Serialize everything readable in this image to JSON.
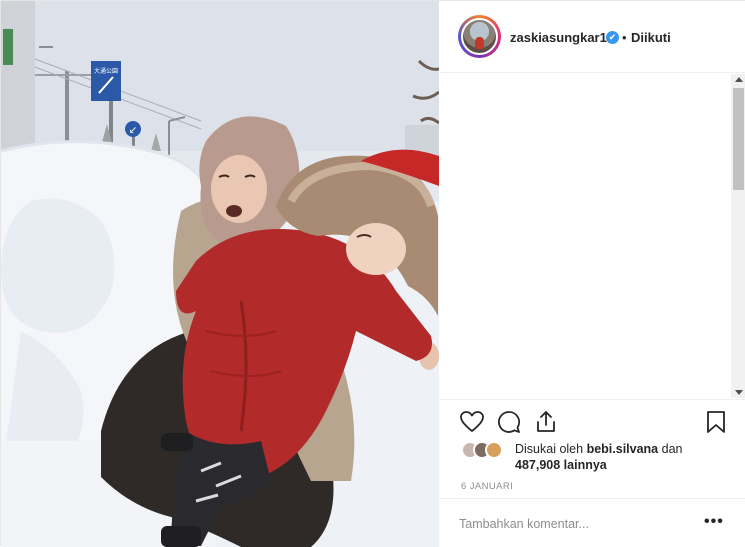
{
  "header": {
    "username": "zaskiasungkar15",
    "verified_mark": "✔",
    "separator": "•",
    "follow_status": "Diikuti"
  },
  "photo": {
    "street_sign_text": "大通公園",
    "road_sign": "↙"
  },
  "actions": {
    "like_icon": "heart-icon",
    "comment_icon": "comment-icon",
    "share_icon": "share-icon",
    "save_icon": "bookmark-icon"
  },
  "likes": {
    "prefix": "Disukai oleh",
    "liker": "bebi.silvana",
    "conjunction": "dan",
    "count": "487,908",
    "suffix": "lainnya"
  },
  "post_date": "6 JANUARI",
  "comment": {
    "placeholder": "Tambahkan komentar...",
    "more_label": "•••"
  },
  "colors": {
    "verified": "#3897f0",
    "text": "#262626",
    "muted": "#8e8e8e"
  }
}
